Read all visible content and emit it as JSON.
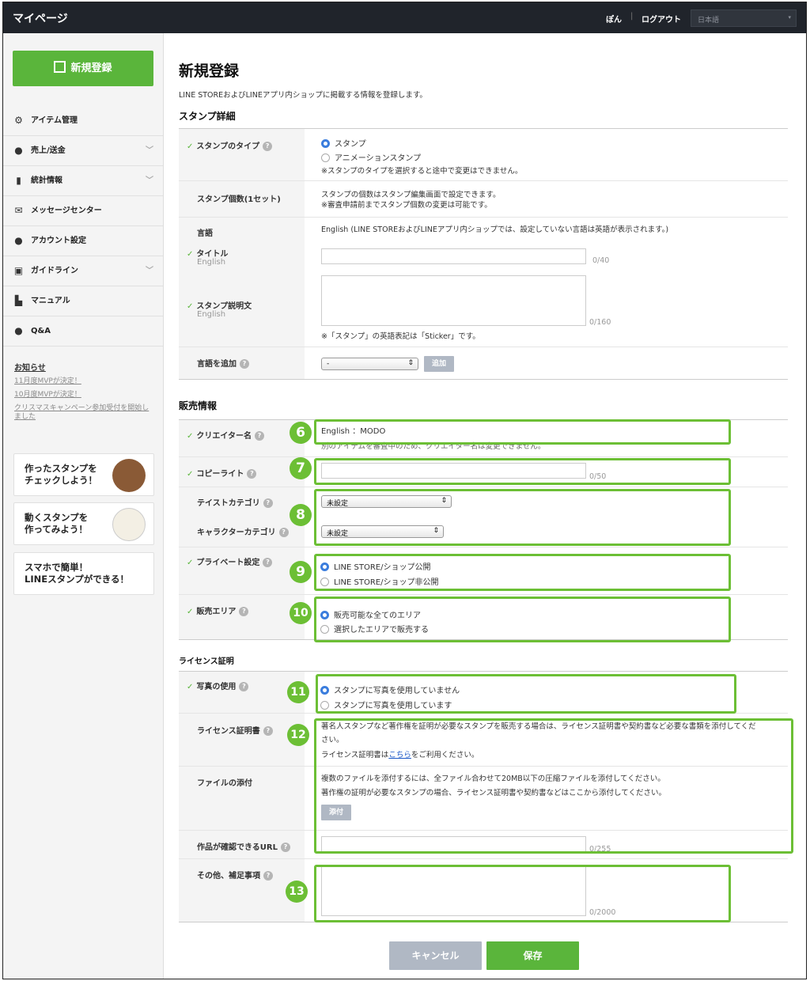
{
  "header": {
    "title": "マイページ",
    "user": "ぽん",
    "logout": "ログアウト",
    "language": "日本語"
  },
  "sidebar": {
    "new_button": "新規登録",
    "items": [
      {
        "label": "アイテム管理",
        "icon": "gear-icon"
      },
      {
        "label": "売上/送金",
        "icon": "coins-icon"
      },
      {
        "label": "統計情報",
        "icon": "bar-chart-icon"
      },
      {
        "label": "メッセージセンター",
        "icon": "envelope-icon"
      },
      {
        "label": "アカウント設定",
        "icon": "user-icon"
      },
      {
        "label": "ガイドライン",
        "icon": "book-icon"
      },
      {
        "label": "マニュアル",
        "icon": "document-icon"
      },
      {
        "label": "Q&A",
        "icon": "question-bubble-icon"
      }
    ],
    "news_title": "お知らせ",
    "news": [
      "11月度MVPが決定！",
      "10月度MVPが決定！",
      "クリスマスキャンペーン参加受付を開始しました"
    ],
    "cards": [
      {
        "line1": "作ったスタンプを",
        "line2": "チェックしよう！"
      },
      {
        "line1": "動くスタンプを",
        "line2": "作ってみよう！"
      },
      {
        "line1": "スマホで簡単！",
        "line2": "LINEスタンプができる！"
      }
    ]
  },
  "main": {
    "title": "新規登録",
    "lead": "LINE STOREおよびLINEアプリ内ショップに掲載する情報を登録します。",
    "detail": {
      "heading": "スタンプ詳細",
      "type_label": "スタンプのタイプ",
      "type_options": [
        "スタンプ",
        "アニメーションスタンプ"
      ],
      "type_note": "※スタンプのタイプを選択すると途中で変更はできません。",
      "count_label": "スタンプ個数(1セット)",
      "count_note1": "スタンプの個数はスタンプ編集画面で設定できます。",
      "count_note2": "※審査申請前までスタンプ個数の変更は可能です。",
      "lang_label": "言語",
      "lang_value": "English (LINE STOREおよびLINEアプリ内ショップでは、設定していない言語は英語が表示されます。)",
      "title_label": "タイトル",
      "title_sub": "English",
      "title_count": "0/40",
      "desc_label": "スタンプ説明文",
      "desc_sub": "English",
      "desc_count": "0/160",
      "desc_note": "※「スタンプ」の英語表記は「Sticker」です。",
      "add_lang_label": "言語を追加",
      "add_lang_select": "-",
      "add_button": "追加"
    },
    "sales": {
      "heading": "販売情報",
      "creator_label": "クリエイター名",
      "creator_value": "English ：MODO",
      "creator_note": "別のアイテムを審査中のため、クリエイター名は変更できません。",
      "copyright_label": "コピーライト",
      "copyright_count": "0/50",
      "taste_label": "テイストカテゴリ",
      "taste_value": "未設定",
      "char_label": "キャラクターカテゴリ",
      "char_value": "未設定",
      "private_label": "プライベート設定",
      "private_options": [
        "LINE STORE/ショップ公開",
        "LINE STORE/ショップ非公開"
      ],
      "area_label": "販売エリア",
      "area_options": [
        "販売可能な全てのエリア",
        "選択したエリアで販売する"
      ]
    },
    "license": {
      "heading": "ライセンス証明",
      "photo_label": "写真の使用",
      "photo_options": [
        "スタンプに写真を使用していません",
        "スタンプに写真を使用しています"
      ],
      "cert_label": "ライセンス証明書",
      "cert_text1": "著名人スタンプなど著作権を証明が必要なスタンプを販売する場合は、ライセンス証明書や契約書など必要な書類を添付してくだ",
      "cert_text2": "さい。",
      "cert_text3a": "ライセンス証明書は",
      "cert_link": "こちら",
      "cert_text3b": "をご利用ください。",
      "file_label": "ファイルの添付",
      "file_text1": "複数のファイルを添付するには、全ファイル合わせて20MB以下の圧縮ファイルを添付してください。",
      "file_text2": "著作権の証明が必要なスタンプの場合、ライセンス証明書や契約書などはここから添付してください。",
      "attach_button": "添付",
      "url_label": "作品が確認できるURL",
      "url_count": "0/255",
      "other_label": "その他、補足事項",
      "other_count": "0/2000"
    },
    "markers": [
      "6",
      "7",
      "8",
      "9",
      "10",
      "11",
      "12",
      "13"
    ],
    "cancel": "キャンセル",
    "save": "保存"
  },
  "colors": {
    "accent": "#5ab53b",
    "highlight": "#6cbf35",
    "topbar": "#20242b",
    "link": "#1a57c7"
  }
}
